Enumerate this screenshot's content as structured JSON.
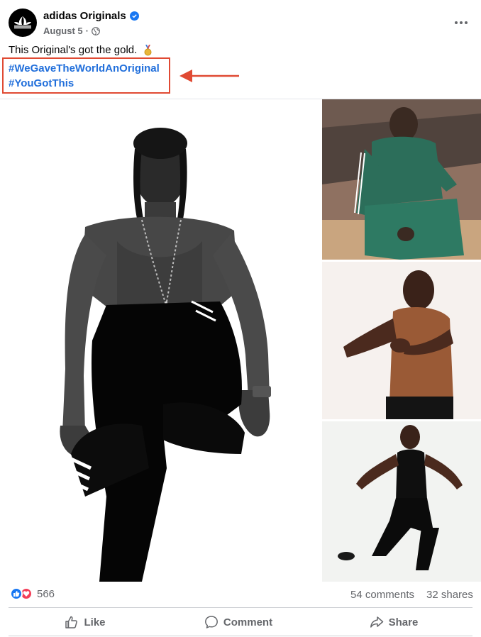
{
  "post": {
    "author": "adidas Originals",
    "date": "August 5",
    "dot": "·",
    "caption": "This Original's got the gold.",
    "hashtags": [
      "#WeGaveTheWorldAnOriginal",
      "#YouGotThis"
    ],
    "icons": {
      "avatar": "adidas-trefoil-logo",
      "verified": "verified-badge-icon",
      "audience": "globe-icon",
      "more": "more-options-icon",
      "emoji": "gold-medal-icon",
      "annotation": "red-left-arrow-icon"
    },
    "colors": {
      "hashtag": "#216fdb",
      "highlight_box": "#e04a33",
      "like_reaction": "#1877f2",
      "love_reaction": "#f33e58"
    }
  },
  "stats": {
    "reaction_count": "566",
    "comments": "54 comments",
    "shares": "32 shares"
  },
  "actions": {
    "like": "Like",
    "comment": "Comment",
    "share": "Share"
  }
}
